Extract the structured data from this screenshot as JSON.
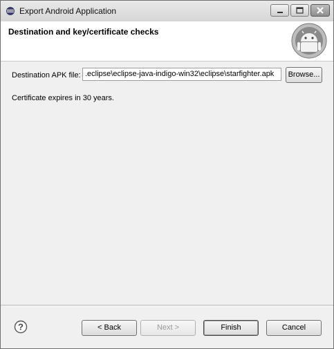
{
  "window": {
    "title": "Export Android Application"
  },
  "header": {
    "title": "Destination and key/certificate checks"
  },
  "form": {
    "destination_label": "Destination APK file:",
    "destination_value": ".eclipse\\eclipse-java-indigo-win32\\eclipse\\starfighter.apk",
    "browse_label": "Browse...",
    "certificate_message": "Certificate expires in 30 years."
  },
  "footer": {
    "back_label": "< Back",
    "next_label": "Next >",
    "finish_label": "Finish",
    "cancel_label": "Cancel"
  },
  "icons": {
    "app_icon": "eclipse-icon",
    "header_logo": "android-logo-icon",
    "help": "help-icon"
  },
  "colors": {
    "dialog_bg": "#f0f0f0",
    "header_bg": "#ffffff"
  },
  "states": {
    "next_enabled": false,
    "default_button": "finish"
  }
}
